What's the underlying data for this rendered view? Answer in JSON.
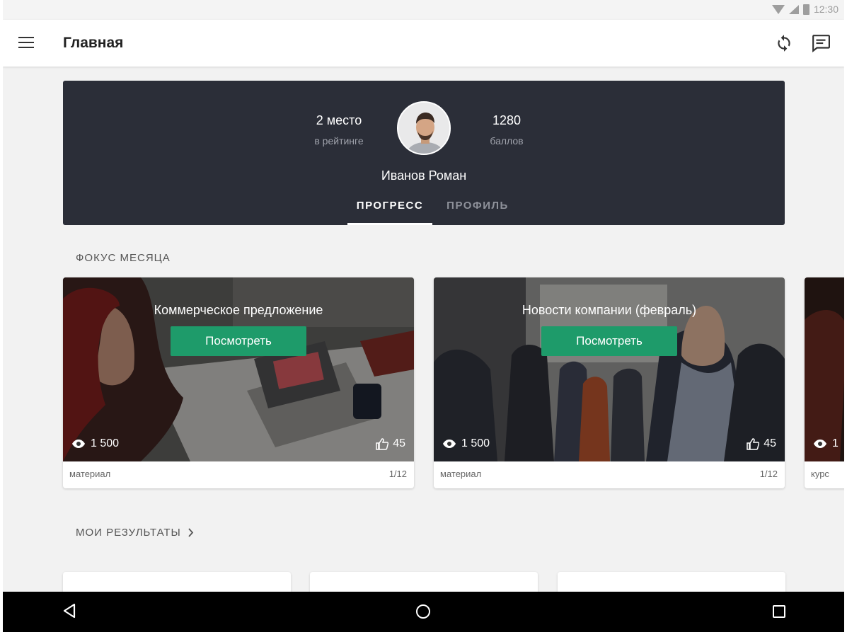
{
  "status_bar": {
    "time": "12:30"
  },
  "app_bar": {
    "title": "Главная"
  },
  "profile": {
    "rank_value": "2 место",
    "rank_label": "в рейтинге",
    "points_value": "1280",
    "points_label": "баллов",
    "name": "Иванов Роман",
    "tabs": [
      {
        "label": "ПРОГРЕСС",
        "active": true
      },
      {
        "label": "ПРОФИЛЬ",
        "active": false
      }
    ]
  },
  "focus": {
    "title": "ФОКУС МЕСЯЦА",
    "cards": [
      {
        "title": "Коммерческое предложение",
        "button": "Посмотреть",
        "views": "1 500",
        "likes": "45",
        "type": "материал",
        "count": "1/12"
      },
      {
        "title": "Новости компании (февраль)",
        "button": "Посмотреть",
        "views": "1 500",
        "likes": "45",
        "type": "материал",
        "count": "1/12"
      },
      {
        "views": "1",
        "type": "курс"
      }
    ]
  },
  "results": {
    "title": "МОИ РЕЗУЛЬТАТЫ"
  },
  "colors": {
    "banner": "#2b2e38",
    "accent": "#1e9b6a",
    "navbar": "#000000"
  },
  "icons": [
    "menu-icon",
    "refresh-icon",
    "chat-icon",
    "eye-icon",
    "thumbs-up-icon",
    "chevron-right-icon",
    "back-icon",
    "home-icon",
    "recents-icon"
  ]
}
